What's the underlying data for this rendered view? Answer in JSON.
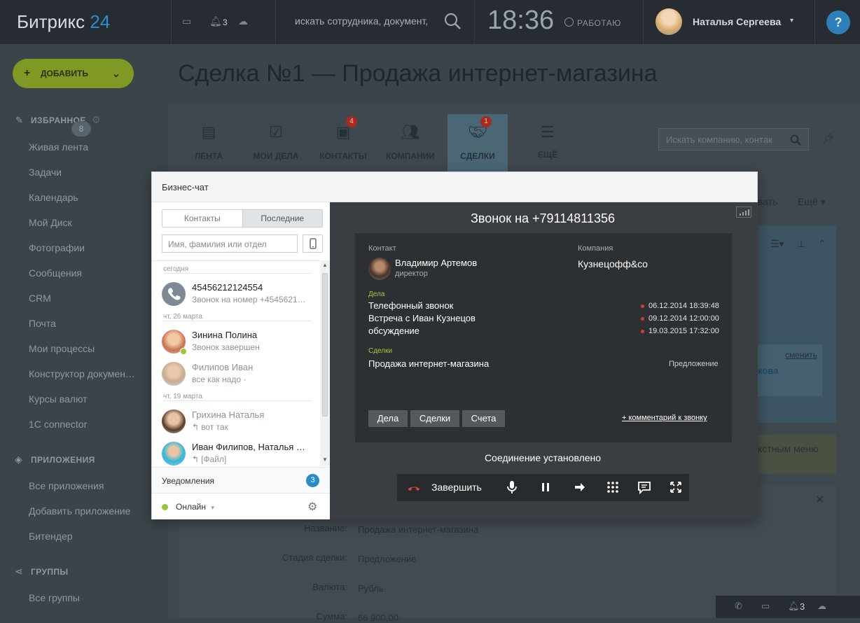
{
  "topbar": {
    "logo_text": "Битрикс",
    "logo_num": "24",
    "notifications_count": "3",
    "search_placeholder": "искать сотрудника, документ,",
    "clock": "18:36",
    "status": "РАБОТАЮ",
    "username": "Наталья Сергеева",
    "help": "?"
  },
  "sidebar": {
    "add_button": "ДОБАВИТЬ",
    "favorites_header": "ИЗБРАННОЕ",
    "favorites": [
      "Живая лента",
      "Задачи",
      "Календарь",
      "Мой Диск",
      "Фотографии",
      "Сообщения",
      "CRM",
      "Почта",
      "Мои процессы",
      "Конструктор докумен…",
      "Курсы валют",
      "1C connector"
    ],
    "tasks_badge": "8",
    "apps_header": "ПРИЛОЖЕНИЯ",
    "apps": [
      "Все приложения",
      "Добавить приложение",
      "Битендер"
    ],
    "groups_header": "ГРУППЫ",
    "groups": [
      "Все группы"
    ]
  },
  "page": {
    "title": "Сделка №1 — Продажа интернет-магазина",
    "crm_tabs": [
      {
        "label": "ЛЕНТА",
        "icon": "feed-icon",
        "badge": ""
      },
      {
        "label": "МОИ ДЕЛА",
        "icon": "tasks-icon",
        "badge": ""
      },
      {
        "label": "КОНТАКТЫ",
        "icon": "contacts-icon",
        "badge": "4"
      },
      {
        "label": "КОМПАНИИ",
        "icon": "companies-icon",
        "badge": ""
      },
      {
        "label": "СДЕЛКИ",
        "icon": "deals-icon",
        "badge": "1"
      },
      {
        "label": "ЕЩЁ",
        "icon": "more-icon",
        "badge": ""
      }
    ],
    "crm_search_placeholder": "Искать компанию, контак",
    "right_fragment_1": "вать",
    "right_more": "Ещё",
    "change_link": "сменить",
    "fragment_name": "кова",
    "fragment_menu": "кстным меню",
    "fields": [
      {
        "label": "Название:",
        "value": "Продажа интернет-магазина"
      },
      {
        "label": "Стадия сделки:",
        "value": "Предложение"
      },
      {
        "label": "Валюта:",
        "value": "Рубль"
      },
      {
        "label": "Сумма:",
        "value": "66 900,00"
      }
    ],
    "tray_count": "3"
  },
  "chat": {
    "title": "Бизнес-чат",
    "tabs": {
      "contacts": "Контакты",
      "recent": "Последние"
    },
    "search_placeholder": "Имя, фамилия или отдел",
    "groups": [
      {
        "date": "сегодня",
        "items": [
          {
            "name": "45456212124554",
            "sub": "Звонок на номер +4545621…",
            "avatar": "phone"
          }
        ]
      },
      {
        "date": "чт, 26 марта",
        "items": [
          {
            "name": "Зинина Полина",
            "sub": "Звонок завершен",
            "avatar": "woman1"
          },
          {
            "name": "Филипов Иван",
            "sub": "все как надо ·",
            "avatar": "man1"
          }
        ]
      },
      {
        "date": "чт, 19 марта",
        "items": [
          {
            "name": "Грихина Наталья",
            "sub": "вот так",
            "avatar": "woman2"
          },
          {
            "name": "Иван Филипов, Наталья …",
            "sub": "[Файл]",
            "avatar": "group"
          }
        ]
      }
    ],
    "notifications_label": "Уведомления",
    "notifications_count": "3",
    "online_label": "Онлайн",
    "call": {
      "title": "Звонок на +79114811356",
      "contact_label": "Контакт",
      "contact_name": "Владимир Артемов",
      "contact_role": "директор",
      "company_label": "Компания",
      "company_name": "Кузнецофф&co",
      "tasks_label": "Дела",
      "tasks": [
        {
          "title": "Телефонный звонок",
          "date": "06.12.2014 18:39:48"
        },
        {
          "title": "Встреча с Иван Кузнецов",
          "date": "09.12.2014 12:00:00"
        },
        {
          "title": "обсуждение",
          "date": "19.03.2015 17:32:00"
        }
      ],
      "deals_label": "Сделки",
      "deal_title": "Продажа интернет-магазина",
      "deal_stage": "Предложение",
      "buttons": [
        "Дела",
        "Сделки",
        "Счета"
      ],
      "comment_link": "+ комментарий к звонку",
      "connection_status": "Соединение установлено",
      "hangup_label": "Завершить"
    }
  },
  "colors": {
    "accent": "#2d8cc6",
    "add_green": "#9dc43a",
    "red": "#d83a2e",
    "call_bg": "#3a3e42"
  }
}
